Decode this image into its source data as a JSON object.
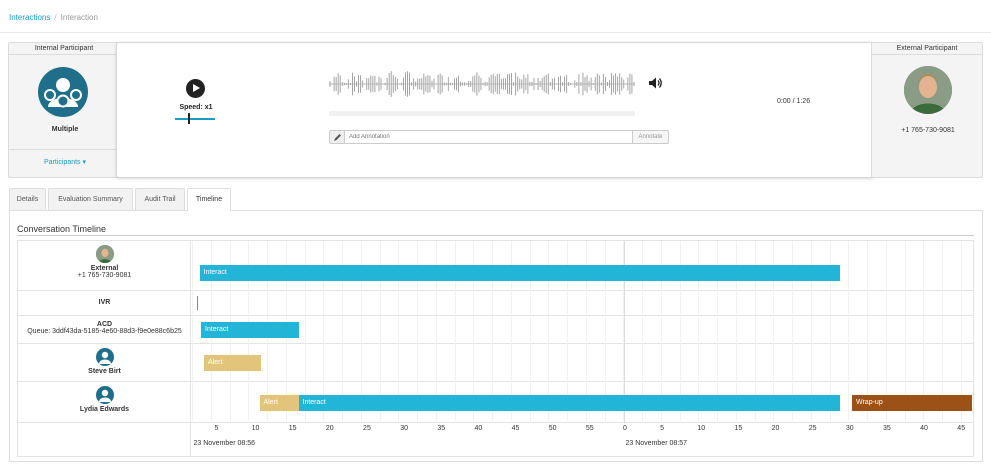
{
  "breadcrumb": {
    "link": "Interactions",
    "separator": "/",
    "current": "Interaction"
  },
  "left_panel": {
    "title": "Internal Participant",
    "name": "Multiple",
    "dropdown": "Participants ▾"
  },
  "right_panel": {
    "title": "External Participant",
    "phone": "+1 765-730-9081"
  },
  "player": {
    "speed_label": "Speed: x1",
    "time": "0:00 / 1:26",
    "annotation_placeholder": "Add Annotation",
    "annotate_button": "Annotate"
  },
  "tabs": [
    {
      "label": "Details",
      "active": false
    },
    {
      "label": "Evaluation Summary",
      "active": false
    },
    {
      "label": "Audit Trail",
      "active": false
    },
    {
      "label": "Timeline",
      "active": true
    }
  ],
  "timeline": {
    "title": "Conversation Timeline",
    "rows": [
      {
        "name": "External",
        "sub": "+1 765-730-9081",
        "avatar": "photo"
      },
      {
        "name": "IVR",
        "sub": "",
        "avatar": "none"
      },
      {
        "name": "ACD",
        "sub": "Queue: 3ddf43da-5185-4e60-88d3-f9e0e88c6b25",
        "avatar": "none"
      },
      {
        "name": "Steve Birt",
        "sub": "",
        "avatar": "user-icon"
      },
      {
        "name": "Lydia Edwards",
        "sub": "",
        "avatar": "user-icon"
      }
    ],
    "segments": [
      {
        "row": 0,
        "label": "Interact",
        "type": "interact",
        "start": 0.5,
        "end": 43.2
      },
      {
        "row": 1,
        "label": "",
        "type": "ivr",
        "start": 0.3,
        "end": 0.3
      },
      {
        "row": 2,
        "label": "Interact",
        "type": "interact",
        "start": 0.6,
        "end": 7.1
      },
      {
        "row": 3,
        "label": "Alert",
        "type": "alert",
        "start": 0.8,
        "end": 4.6
      },
      {
        "row": 4,
        "label": "Alert",
        "type": "alert",
        "start": 4.5,
        "end": 7.1
      },
      {
        "row": 4,
        "label": "Interact",
        "type": "interact",
        "start": 7.1,
        "end": 43.2
      },
      {
        "row": 4,
        "label": "Wrap-up",
        "type": "wrapup",
        "start": 44.0,
        "end": 52.0
      }
    ],
    "axis": {
      "ticks": [
        "5",
        "10",
        "15",
        "20",
        "25",
        "30",
        "35",
        "40",
        "45",
        "50",
        "55",
        "0",
        "5",
        "10",
        "15",
        "20",
        "25",
        "30",
        "35",
        "40",
        "45"
      ],
      "dates": [
        "23 November 08:56",
        "23 November 08:57"
      ]
    }
  },
  "colors": {
    "accent": "#1a9bc2",
    "interact": "#22b5d8",
    "alert": "#e2c57b",
    "wrapup": "#9c5116",
    "avatar": "#1f6f8b"
  }
}
